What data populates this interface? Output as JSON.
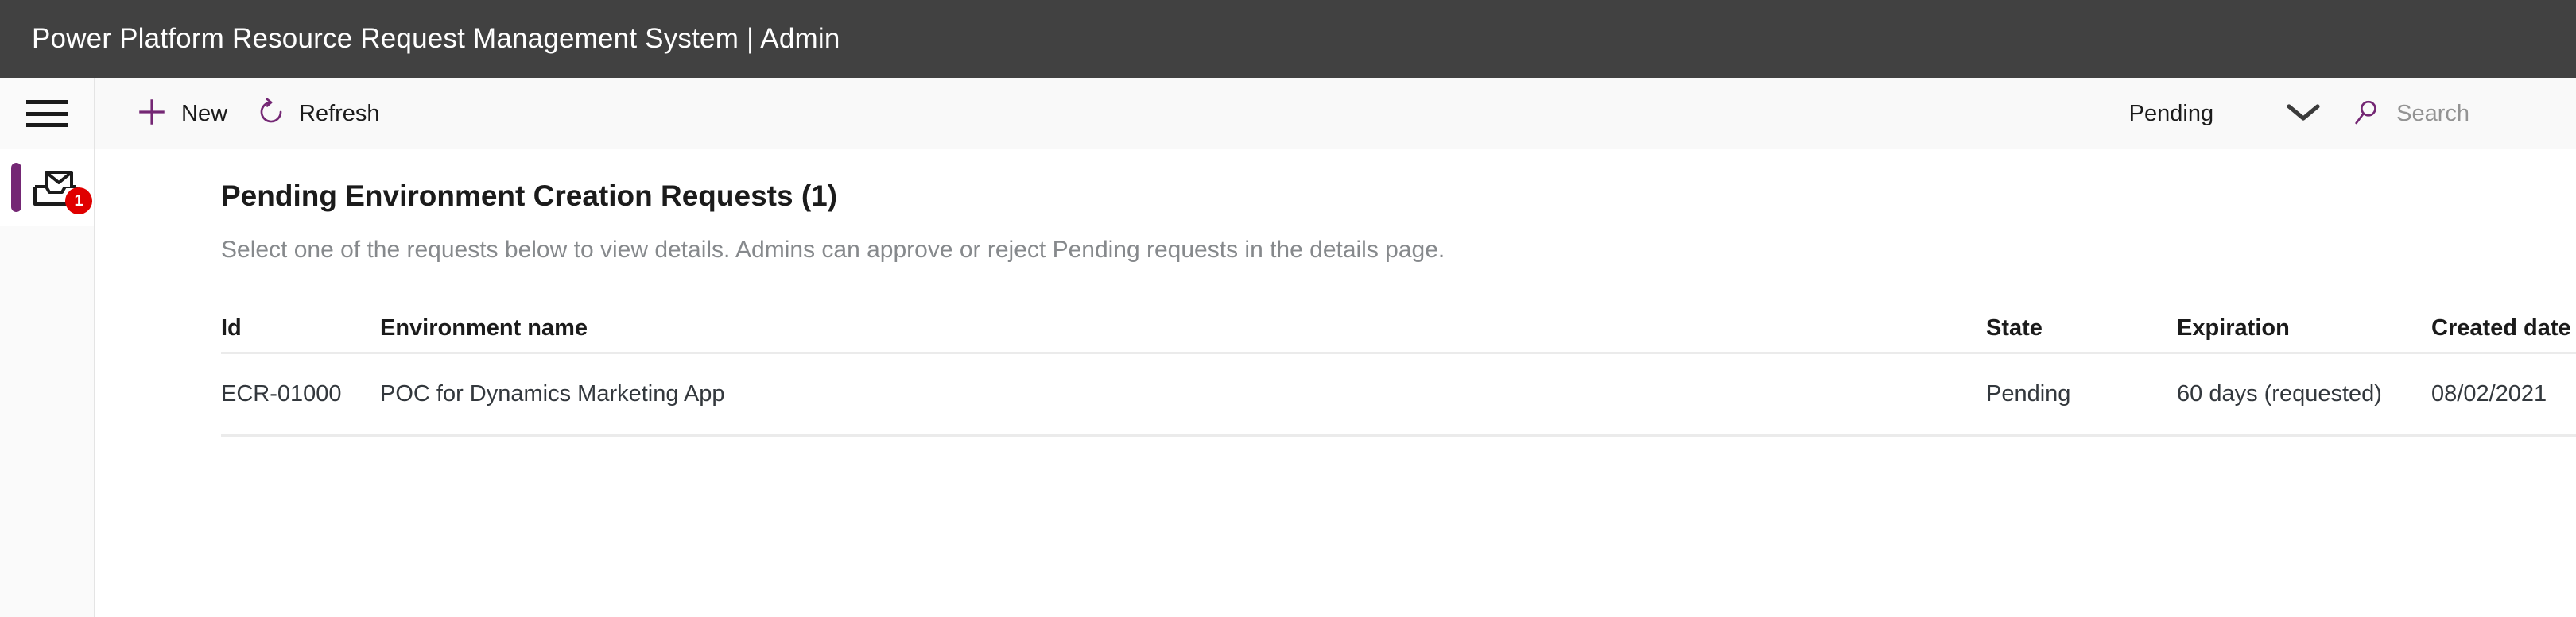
{
  "titlebar": {
    "title": "Power Platform Resource Request Management System | Admin"
  },
  "rail": {
    "hamburger_icon": "hamburger-menu-icon",
    "items": [
      {
        "icon": "inbox-tray-icon",
        "badge": "1",
        "selected": true
      }
    ]
  },
  "commandbar": {
    "new_label": "New",
    "new_icon": "plus-icon",
    "refresh_label": "Refresh",
    "refresh_icon": "refresh-circular-arrow-icon",
    "filter_value": "Pending",
    "chevron_icon": "chevron-down-icon",
    "search_icon": "search-magnifier-icon",
    "search_value": "",
    "search_placeholder": "Search"
  },
  "content": {
    "page_title": "Pending Environment Creation Requests (1)",
    "page_description": "Select one of the requests below to view details. Admins can approve or reject Pending requests in the details page."
  },
  "table": {
    "columns": [
      "Id",
      "Environment name",
      "State",
      "Expiration",
      "Created date"
    ],
    "rows": [
      {
        "id": "ECR-01000",
        "name": "POC for Dynamics Marketing App",
        "state": "Pending",
        "expiration": "60 days (requested)",
        "created_date": "08/02/2021"
      }
    ]
  },
  "colors": {
    "titlebar_bg": "#414141",
    "accent_purple": "#742774",
    "badge_red": "#e00000",
    "commandbar_bg": "#f9f9f9",
    "muted_text": "#86898c"
  }
}
